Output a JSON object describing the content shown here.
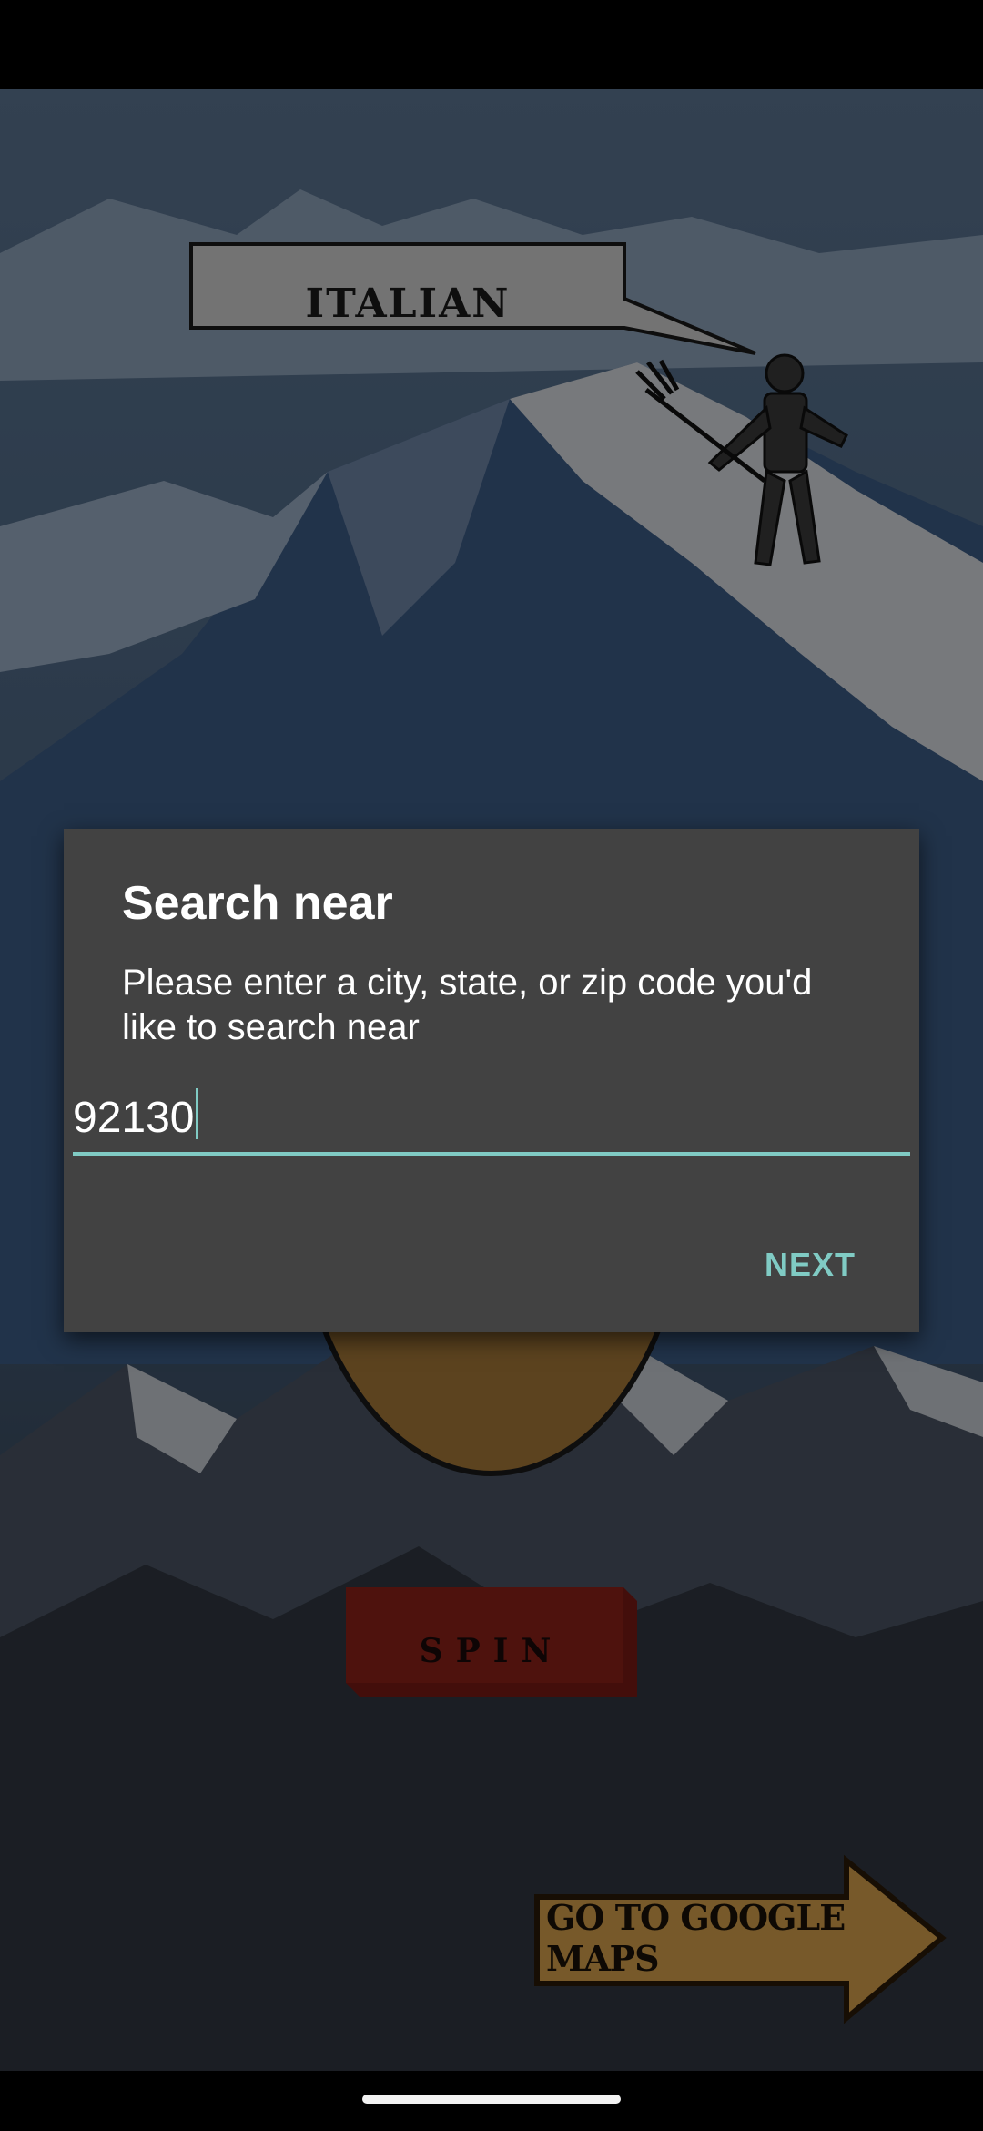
{
  "game": {
    "cuisine_label": "ITALIAN",
    "spin_label": "SPIN",
    "maps_label": "GO TO GOOGLE MAPS"
  },
  "dialog": {
    "title": "Search near",
    "message": "Please enter a city, state, or zip code you'd like to search near",
    "input_value": "92130",
    "next_label": "NEXT"
  },
  "colors": {
    "dialog_bg": "#424242",
    "accent": "#80cbc4"
  }
}
